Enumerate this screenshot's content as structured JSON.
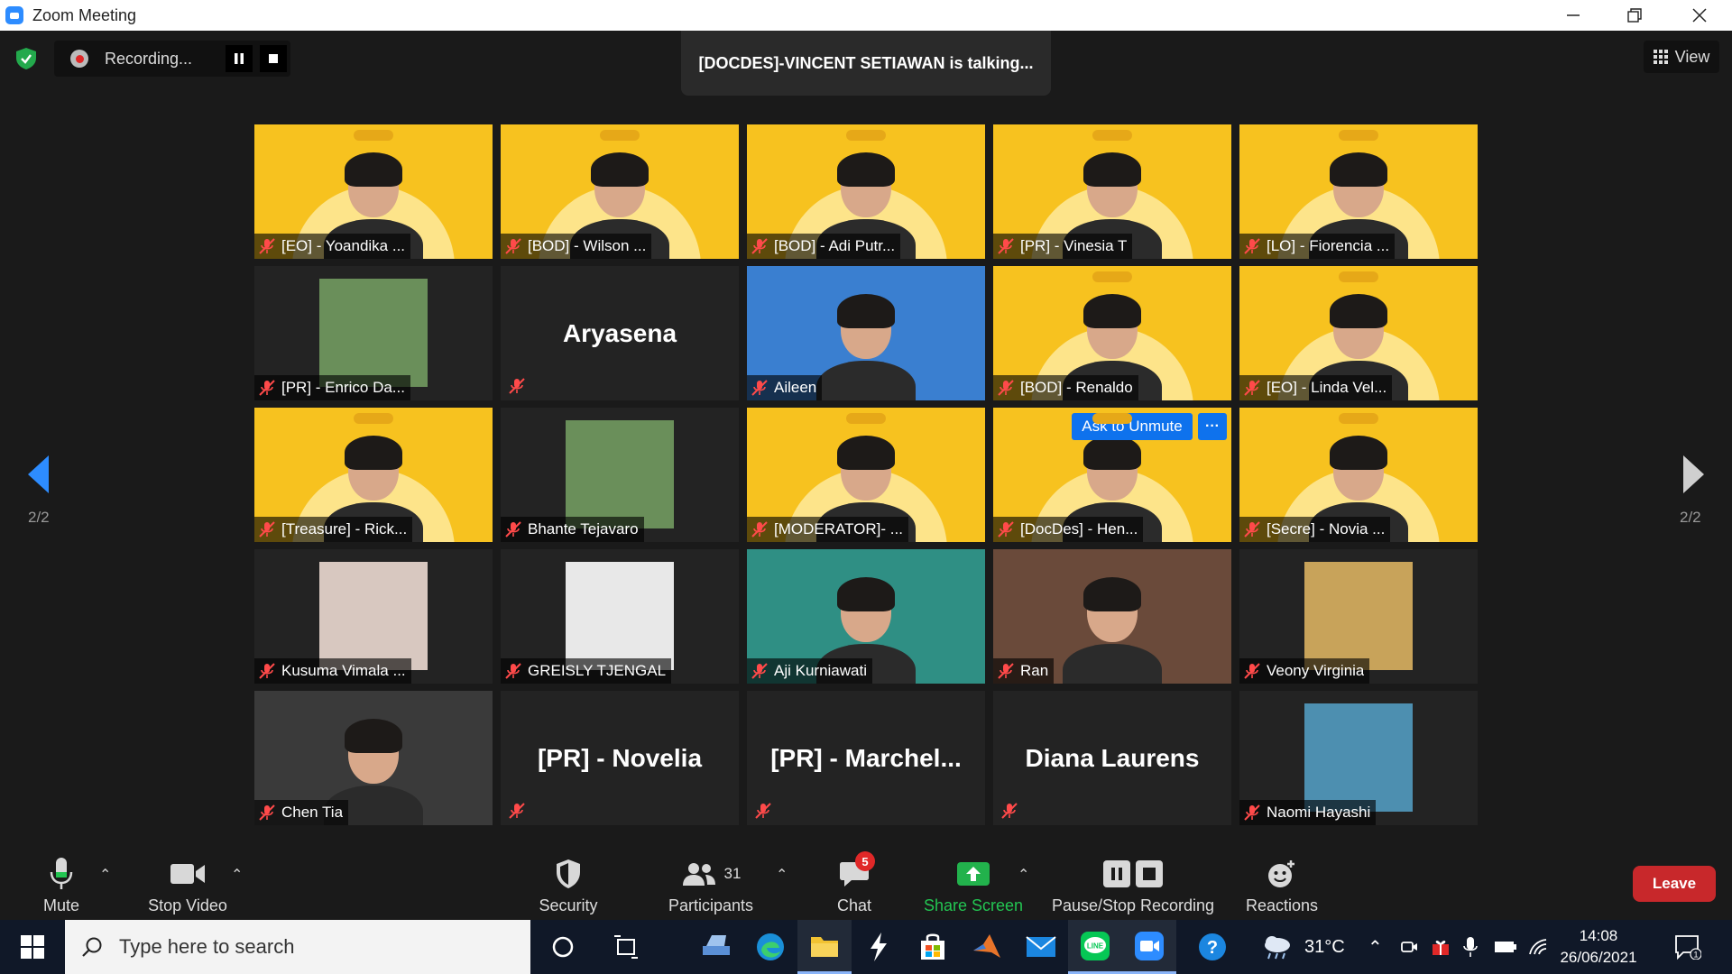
{
  "window": {
    "title": "Zoom Meeting"
  },
  "recording": {
    "label": "Recording..."
  },
  "banner": {
    "talking": "[DOCDES]-VINCENT SETIAWAN is talking..."
  },
  "view": {
    "label": "View"
  },
  "paging": {
    "left": "2/2",
    "right": "2/2"
  },
  "tiles": [
    {
      "name": "[EO] - Yoandika ...",
      "kind": "yellow"
    },
    {
      "name": "[BOD] - Wilson ...",
      "kind": "yellow"
    },
    {
      "name": "[BOD] - Adi Putr...",
      "kind": "yellow"
    },
    {
      "name": "[PR] - Vinesia T",
      "kind": "yellow"
    },
    {
      "name": "[LO] - Fiorencia ...",
      "kind": "yellow"
    },
    {
      "name": "[PR] - Enrico Da...",
      "kind": "photo"
    },
    {
      "name": "Aryasena",
      "kind": "text"
    },
    {
      "name": "Aileen",
      "kind": "video"
    },
    {
      "name": "[BOD] - Renaldo",
      "kind": "yellow"
    },
    {
      "name": "[EO] - Linda Vel...",
      "kind": "yellow"
    },
    {
      "name": "[Treasure] - Rick...",
      "kind": "yellow"
    },
    {
      "name": "Bhante Tejavaro",
      "kind": "photo"
    },
    {
      "name": "[MODERATOR]- ...",
      "kind": "yellow"
    },
    {
      "name": "[DocDes] - Hen...",
      "kind": "yellow"
    },
    {
      "name": "[Secre] - Novia ...",
      "kind": "yellow"
    },
    {
      "name": "Kusuma Vimala ...",
      "kind": "photo"
    },
    {
      "name": "GREISLY TJENGAL",
      "kind": "photo"
    },
    {
      "name": "Aji Kurniawati",
      "kind": "video"
    },
    {
      "name": "Ran",
      "kind": "video"
    },
    {
      "name": "Veony Virginia",
      "kind": "photo"
    },
    {
      "name": "Chen Tia",
      "kind": "video"
    },
    {
      "name": "[PR] - Novelia",
      "kind": "text"
    },
    {
      "name": "[PR]  -  Marchel...",
      "kind": "text"
    },
    {
      "name": "Diana Laurens",
      "kind": "text"
    },
    {
      "name": "Naomi Hayashi",
      "kind": "photo"
    }
  ],
  "hover_actions": {
    "ask_to_unmute": "Ask to Unmute",
    "more": "···"
  },
  "toolbar": {
    "mute": "Mute",
    "stop_video": "Stop Video",
    "security": "Security",
    "participants": "Participants",
    "participants_count": "31",
    "chat": "Chat",
    "chat_badge": "5",
    "share_screen": "Share Screen",
    "pause_stop_recording": "Pause/Stop Recording",
    "reactions": "Reactions",
    "leave": "Leave"
  },
  "taskbar": {
    "search_placeholder": "Type here to search",
    "weather": "31°C",
    "time": "14:08",
    "date": "26/06/2021",
    "notifications": "1"
  },
  "colors": {
    "accent_blue": "#0e72ed",
    "share_green": "#22b24c",
    "leave_red": "#c8282b",
    "tile_yellow": "#f7c21f"
  }
}
